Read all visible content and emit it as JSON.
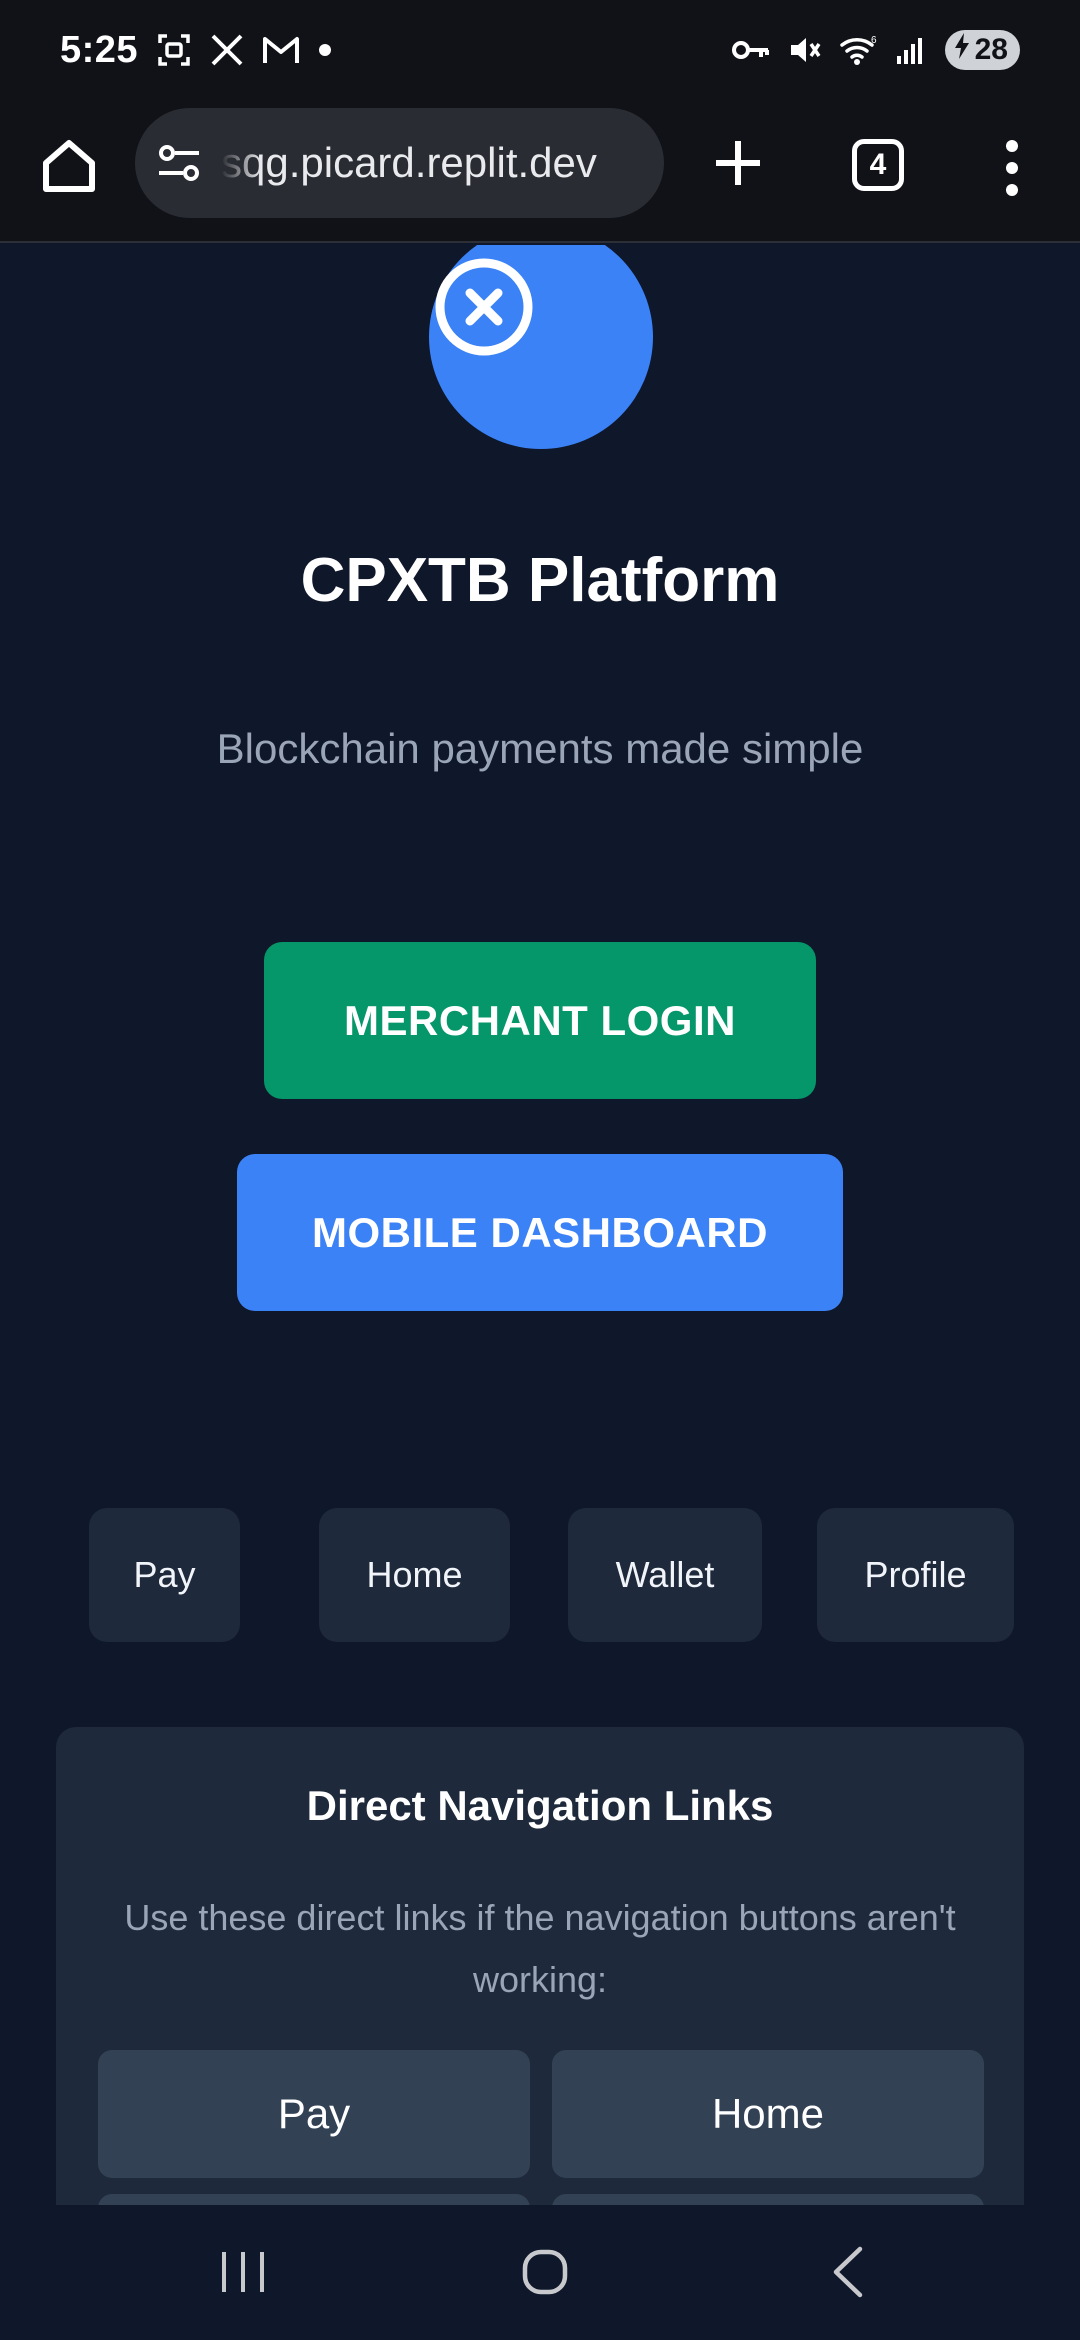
{
  "status_bar": {
    "time": "5:25",
    "left_icons": [
      "screenshot-icon",
      "x-app-icon",
      "gmail-icon",
      "notification-dot-icon"
    ],
    "right_icons": [
      "vpn-key-icon",
      "mute-icon",
      "wifi-6-icon",
      "signal-icon"
    ],
    "battery_level": "28",
    "battery_charging": true
  },
  "browser": {
    "url": "sqg.picard.replit.dev",
    "tab_count": "4"
  },
  "app": {
    "title": "CPXTB Platform",
    "tagline": "Blockchain payments made simple",
    "logo_color": "#3b82f6"
  },
  "actions": {
    "merchant_login": "MERCHANT LOGIN",
    "mobile_dashboard": "MOBILE DASHBOARD",
    "merchant_color": "#059669",
    "dashboard_color": "#3b82f6"
  },
  "nav_chips": [
    "Pay",
    "Home",
    "Wallet",
    "Profile"
  ],
  "direct_links": {
    "title": "Direct Navigation Links",
    "description": "Use these direct links if the navigation buttons aren't working:",
    "links": [
      "Pay",
      "Home"
    ]
  },
  "colors": {
    "background": "#0f172a",
    "card": "#1e293b",
    "muted_text": "#9aa6b8"
  }
}
